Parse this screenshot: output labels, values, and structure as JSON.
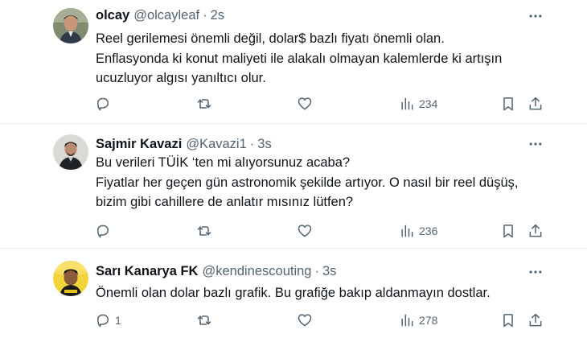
{
  "tweets": [
    {
      "author": {
        "name": "olcay",
        "handle": "@olcayleaf"
      },
      "time": "2s",
      "text_lines": [
        "Reel gerilemesi önemli değil, dolar$ bazlı fiyatı önemli olan.",
        "Enflasyonda ki konut maliyeti ile alakalı olmayan kalemlerde ki artışın",
        "ucuzluyor algısı yanıltıcı olur."
      ],
      "reply_count": "",
      "retweet_count": "",
      "like_count": "",
      "view_count": "234"
    },
    {
      "author": {
        "name": "Sajmir Kavazi",
        "handle": "@Kavazi1"
      },
      "time": "3s",
      "text_lines": [
        "Bu verileri TÜİK ‘ten mi alıyorsunuz acaba?",
        "Fiyatlar her geçen gün astronomik şekilde artıyor. O nasıl bir reel düşüş,",
        "bizim gibi cahillere de anlatır mısınız lütfen?"
      ],
      "reply_count": "",
      "retweet_count": "",
      "like_count": "",
      "view_count": "236"
    },
    {
      "author": {
        "name": "Sarı Kanarya FK",
        "handle": "@kendinescouting"
      },
      "time": "3s",
      "text_lines": [
        "Önemli olan dolar bazlı grafik. Bu grafiğe bakıp aldanmayın dostlar."
      ],
      "reply_count": "1",
      "retweet_count": "",
      "like_count": "",
      "view_count": "278"
    }
  ],
  "separator": "·",
  "icons": {
    "reply": "reply-icon",
    "retweet": "retweet-icon",
    "like": "heart-icon",
    "views": "views-icon",
    "bookmark": "bookmark-icon",
    "share": "share-icon",
    "more": "more-dots-icon"
  },
  "colors": {
    "text": "#0f1419",
    "secondary": "#536471",
    "divider": "#e6ecf0"
  }
}
